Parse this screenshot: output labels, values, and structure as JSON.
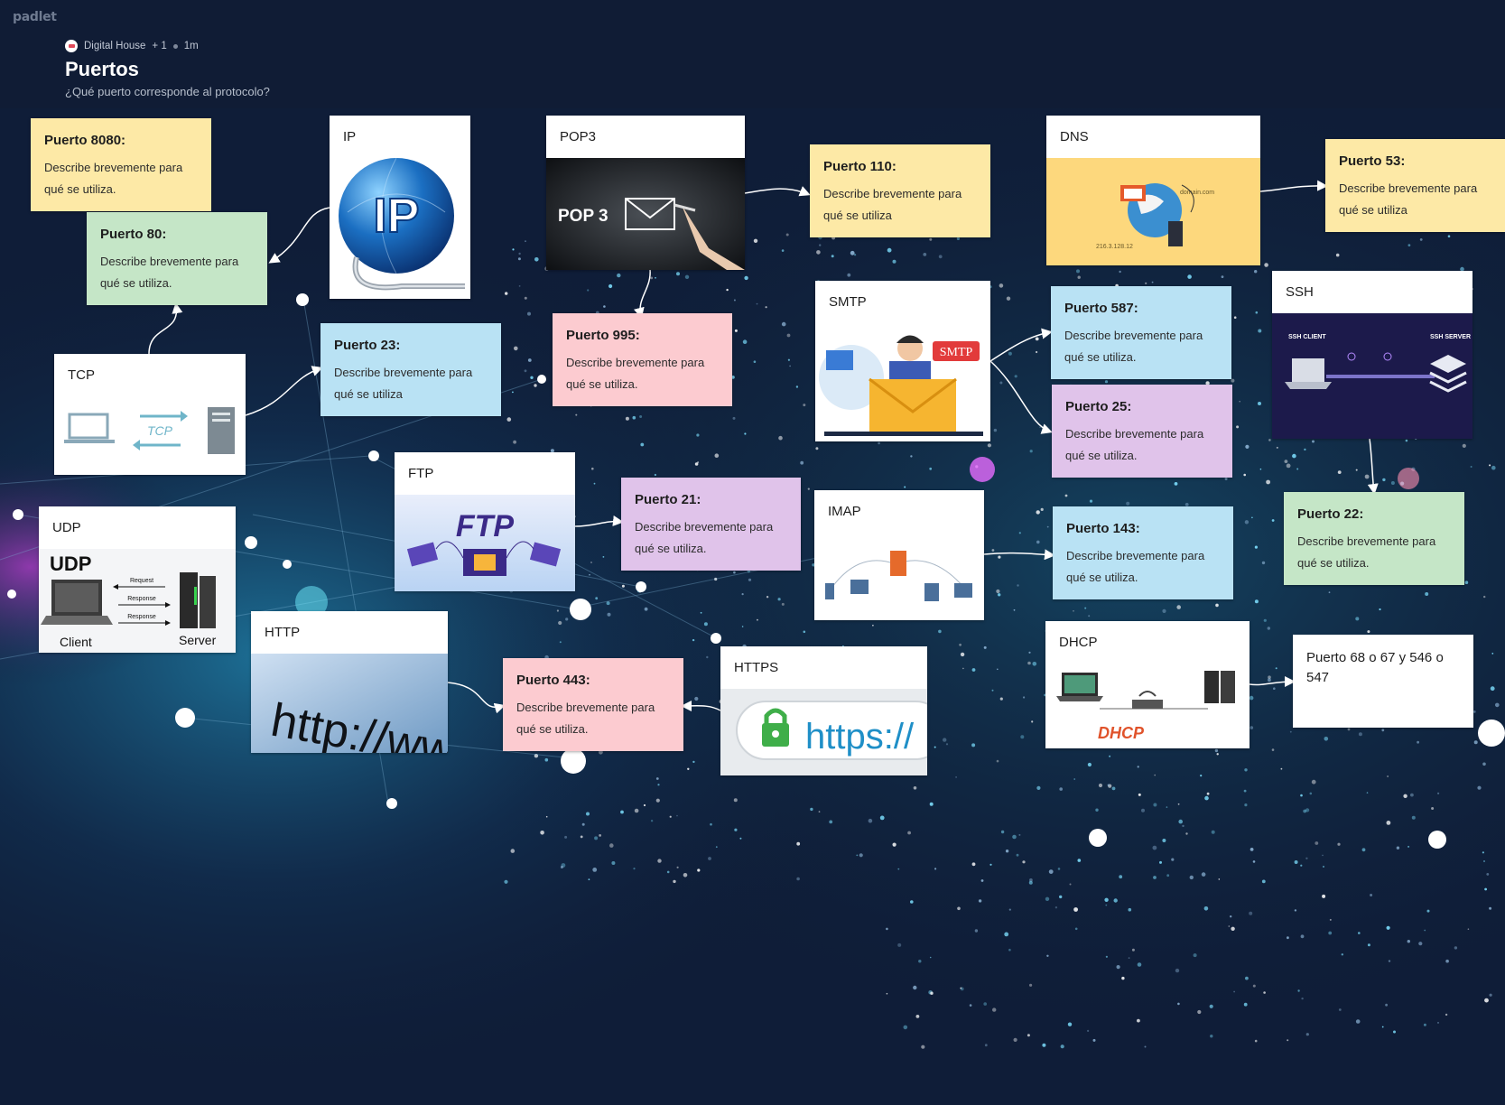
{
  "app": {
    "brand": "padlet"
  },
  "header": {
    "author": "Digital House",
    "contributors": "+ 1",
    "time": "1m",
    "title": "Puertos",
    "subtitle": "¿Qué puerto corresponde al protocolo?"
  },
  "protocols": {
    "ip": "IP",
    "pop3": "POP3",
    "dns": "DNS",
    "tcp": "TCP",
    "smtp": "SMTP",
    "ssh": "SSH",
    "udp": "UDP",
    "ftp": "FTP",
    "imap": "IMAP",
    "http": "HTTP",
    "https": "HTTPS",
    "dhcp": "DHCP"
  },
  "image_text": {
    "pop3": "POP 3",
    "tcp": "TCP",
    "udp": "UDP",
    "udp_client": "Client",
    "udp_server": "Server",
    "udp_request": "Request",
    "udp_response": "Response",
    "ftp": "FTP",
    "http": "http://ww",
    "https": "https://",
    "smtp": "SMTP",
    "dhcp": "DHCP",
    "ip": "IP",
    "ssh_client": "SSH CLIENT",
    "ssh_server": "SSH SERVER",
    "dns_domain": "domain.com",
    "dns_ip": "216.3.128.12"
  },
  "notes": {
    "p8080": {
      "title": "Puerto 8080:",
      "body": "Describe brevemente para qué se utiliza."
    },
    "p80": {
      "title": "Puerto 80:",
      "body": "Describe brevemente para qué se utiliza."
    },
    "p110": {
      "title": "Puerto 110:",
      "body": "Describe brevemente para qué se utiliza"
    },
    "p53": {
      "title": "Puerto 53:",
      "body": "Describe brevemente para qué se utiliza"
    },
    "p23": {
      "title": "Puerto 23:",
      "body": "Describe brevemente para qué se utiliza"
    },
    "p995": {
      "title": "Puerto 995:",
      "body": "Describe brevemente para qué se utiliza."
    },
    "p587": {
      "title": "Puerto 587:",
      "body": "Describe brevemente para qué se utiliza."
    },
    "p25": {
      "title": "Puerto 25:",
      "body": "Describe brevemente para qué se utiliza."
    },
    "p21": {
      "title": "Puerto 21:",
      "body": "Describe brevemente para qué se utiliza."
    },
    "p143": {
      "title": "Puerto 143:",
      "body": "Describe brevemente para qué se utiliza."
    },
    "p22": {
      "title": "Puerto 22:",
      "body": "Describe brevemente para qué se utiliza."
    },
    "p443": {
      "title": "Puerto 443:",
      "body": "Describe brevemente para qué se utiliza."
    },
    "p68": {
      "title": "Puerto 68 o 67 y 546 o 547"
    }
  },
  "colors": {
    "background": "#0f1b33",
    "yellow": "#fde9a6",
    "green": "#c5e6c7",
    "blue": "#b9e2f4",
    "pink": "#fccbd0",
    "purple": "#e0c3ea"
  }
}
